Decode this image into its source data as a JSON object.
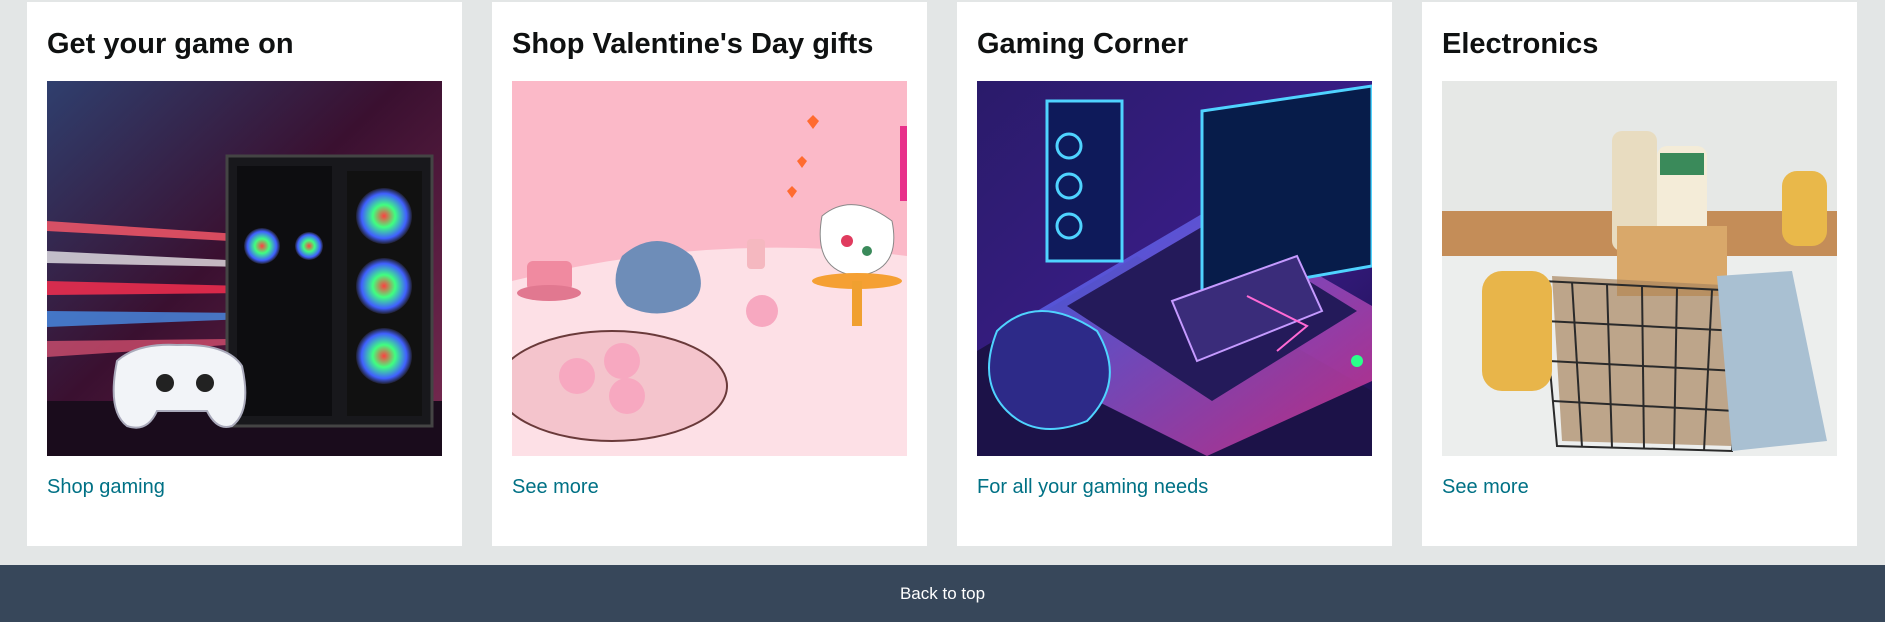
{
  "cards": [
    {
      "title": "Get your game on",
      "link": "Shop gaming",
      "image": "gaming-pc-controller-image"
    },
    {
      "title": "Shop Valentine's Day gifts",
      "link": "See more",
      "image": "valentines-gifts-image"
    },
    {
      "title": "Gaming Corner",
      "link": "For all your gaming needs",
      "image": "gaming-setup-image"
    },
    {
      "title": "Electronics",
      "link": "See more",
      "image": "cleaning-supplies-basket-image"
    }
  ],
  "footer": {
    "back_to_top": "Back to top"
  },
  "colors": {
    "page_bg": "#e3e6e6",
    "link": "#007185",
    "footer_bg": "#37475a"
  }
}
